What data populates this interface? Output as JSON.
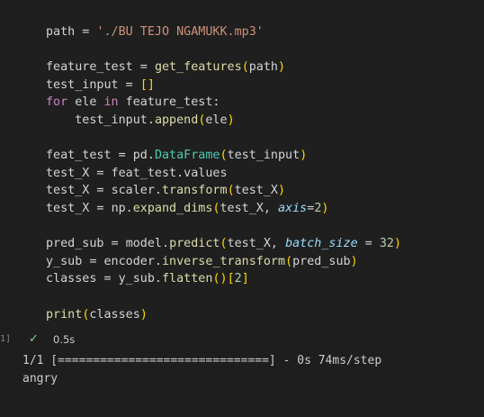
{
  "cell": {
    "execution_count": "1]",
    "status_icon": "check-icon",
    "exec_time": "0.5s",
    "code_lines": [
      {
        "tokens": [
          [
            "path",
            "var"
          ],
          [
            " = ",
            "op"
          ],
          [
            "'./BU TEJO NGAMUKK.mp3'",
            "str"
          ]
        ]
      },
      {
        "tokens": []
      },
      {
        "tokens": [
          [
            "feature_test",
            "var"
          ],
          [
            " = ",
            "op"
          ],
          [
            "get_features",
            "fn"
          ],
          [
            "(",
            "br1"
          ],
          [
            "path",
            "var"
          ],
          [
            ")",
            "br1"
          ]
        ]
      },
      {
        "tokens": [
          [
            "test_input",
            "var"
          ],
          [
            " = ",
            "op"
          ],
          [
            "[]",
            "br1"
          ]
        ]
      },
      {
        "tokens": [
          [
            "for",
            "kw"
          ],
          [
            " ele ",
            "var"
          ],
          [
            "in",
            "kw"
          ],
          [
            " feature_test:",
            "var"
          ]
        ]
      },
      {
        "tokens": [
          [
            "    test_input.",
            "var"
          ],
          [
            "append",
            "fn"
          ],
          [
            "(",
            "br1"
          ],
          [
            "ele",
            "var"
          ],
          [
            ")",
            "br1"
          ]
        ]
      },
      {
        "tokens": []
      },
      {
        "tokens": [
          [
            "feat_test",
            "var"
          ],
          [
            " = ",
            "op"
          ],
          [
            "pd.",
            "var"
          ],
          [
            "DataFrame",
            "cls"
          ],
          [
            "(",
            "br1"
          ],
          [
            "test_input",
            "var"
          ],
          [
            ")",
            "br1"
          ]
        ]
      },
      {
        "tokens": [
          [
            "test_X",
            "var"
          ],
          [
            " = ",
            "op"
          ],
          [
            "feat_test.values",
            "var"
          ]
        ]
      },
      {
        "tokens": [
          [
            "test_X",
            "var"
          ],
          [
            " = ",
            "op"
          ],
          [
            "scaler.",
            "var"
          ],
          [
            "transform",
            "fn"
          ],
          [
            "(",
            "br1"
          ],
          [
            "test_X",
            "var"
          ],
          [
            ")",
            "br1"
          ]
        ]
      },
      {
        "tokens": [
          [
            "test_X",
            "var"
          ],
          [
            " = ",
            "op"
          ],
          [
            "np.",
            "var"
          ],
          [
            "expand_dims",
            "fn"
          ],
          [
            "(",
            "br1"
          ],
          [
            "test_X, ",
            "var"
          ],
          [
            "axis",
            "param"
          ],
          [
            "=",
            "op"
          ],
          [
            "2",
            "num"
          ],
          [
            ")",
            "br1"
          ]
        ]
      },
      {
        "tokens": []
      },
      {
        "tokens": [
          [
            "pred_sub",
            "var"
          ],
          [
            " = ",
            "op"
          ],
          [
            "model.",
            "var"
          ],
          [
            "predict",
            "fn"
          ],
          [
            "(",
            "br1"
          ],
          [
            "test_X, ",
            "var"
          ],
          [
            "batch_size",
            "param"
          ],
          [
            " = ",
            "op"
          ],
          [
            "32",
            "num"
          ],
          [
            ")",
            "br1"
          ]
        ]
      },
      {
        "tokens": [
          [
            "y_sub",
            "var"
          ],
          [
            " = ",
            "op"
          ],
          [
            "encoder.",
            "var"
          ],
          [
            "inverse_transform",
            "fn"
          ],
          [
            "(",
            "br1"
          ],
          [
            "pred_sub",
            "var"
          ],
          [
            ")",
            "br1"
          ]
        ]
      },
      {
        "tokens": [
          [
            "classes",
            "var"
          ],
          [
            " = ",
            "op"
          ],
          [
            "y_sub.",
            "var"
          ],
          [
            "flatten",
            "fn"
          ],
          [
            "()",
            "br1"
          ],
          [
            "[",
            "br1"
          ],
          [
            "2",
            "num"
          ],
          [
            "]",
            "br1"
          ]
        ]
      },
      {
        "tokens": []
      },
      {
        "tokens": [
          [
            "print",
            "fn"
          ],
          [
            "(",
            "br1"
          ],
          [
            "classes",
            "var"
          ],
          [
            ")",
            "br1"
          ]
        ]
      }
    ]
  },
  "output": {
    "lines": [
      "1/1 [==============================] - 0s 74ms/step",
      "angry"
    ]
  },
  "colors": {
    "background": "#1e1e1e",
    "success": "#89d185",
    "string": "#ce9178",
    "function": "#dcdcaa",
    "keyword": "#c586c0",
    "bracket": "#ffd700",
    "number": "#b5cea8",
    "class": "#4ec9b0",
    "parameter": "#9cdcfe"
  }
}
